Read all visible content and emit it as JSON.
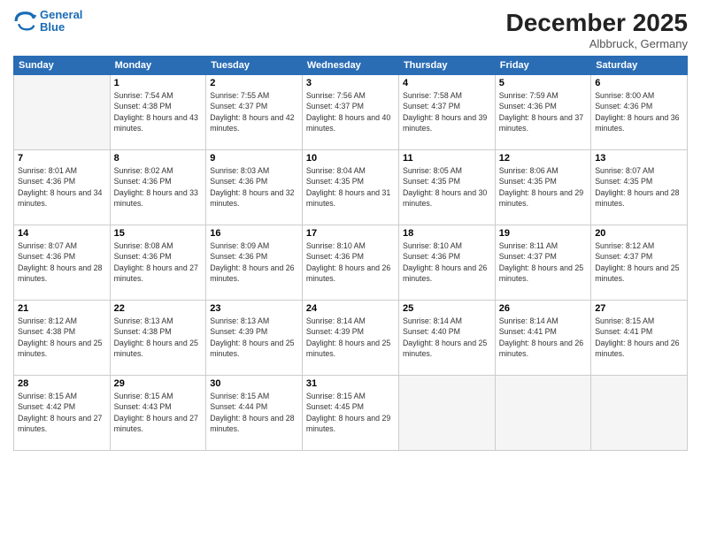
{
  "header": {
    "logo": {
      "line1": "General",
      "line2": "Blue"
    },
    "month_year": "December 2025",
    "location": "Albbruck, Germany"
  },
  "weekdays": [
    "Sunday",
    "Monday",
    "Tuesday",
    "Wednesday",
    "Thursday",
    "Friday",
    "Saturday"
  ],
  "weeks": [
    [
      {
        "day": "",
        "empty": true
      },
      {
        "day": "1",
        "sunrise": "7:54 AM",
        "sunset": "4:38 PM",
        "daylight": "8 hours and 43 minutes."
      },
      {
        "day": "2",
        "sunrise": "7:55 AM",
        "sunset": "4:37 PM",
        "daylight": "8 hours and 42 minutes."
      },
      {
        "day": "3",
        "sunrise": "7:56 AM",
        "sunset": "4:37 PM",
        "daylight": "8 hours and 40 minutes."
      },
      {
        "day": "4",
        "sunrise": "7:58 AM",
        "sunset": "4:37 PM",
        "daylight": "8 hours and 39 minutes."
      },
      {
        "day": "5",
        "sunrise": "7:59 AM",
        "sunset": "4:36 PM",
        "daylight": "8 hours and 37 minutes."
      },
      {
        "day": "6",
        "sunrise": "8:00 AM",
        "sunset": "4:36 PM",
        "daylight": "8 hours and 36 minutes."
      }
    ],
    [
      {
        "day": "7",
        "sunrise": "8:01 AM",
        "sunset": "4:36 PM",
        "daylight": "8 hours and 34 minutes."
      },
      {
        "day": "8",
        "sunrise": "8:02 AM",
        "sunset": "4:36 PM",
        "daylight": "8 hours and 33 minutes."
      },
      {
        "day": "9",
        "sunrise": "8:03 AM",
        "sunset": "4:36 PM",
        "daylight": "8 hours and 32 minutes."
      },
      {
        "day": "10",
        "sunrise": "8:04 AM",
        "sunset": "4:35 PM",
        "daylight": "8 hours and 31 minutes."
      },
      {
        "day": "11",
        "sunrise": "8:05 AM",
        "sunset": "4:35 PM",
        "daylight": "8 hours and 30 minutes."
      },
      {
        "day": "12",
        "sunrise": "8:06 AM",
        "sunset": "4:35 PM",
        "daylight": "8 hours and 29 minutes."
      },
      {
        "day": "13",
        "sunrise": "8:07 AM",
        "sunset": "4:35 PM",
        "daylight": "8 hours and 28 minutes."
      }
    ],
    [
      {
        "day": "14",
        "sunrise": "8:07 AM",
        "sunset": "4:36 PM",
        "daylight": "8 hours and 28 minutes."
      },
      {
        "day": "15",
        "sunrise": "8:08 AM",
        "sunset": "4:36 PM",
        "daylight": "8 hours and 27 minutes."
      },
      {
        "day": "16",
        "sunrise": "8:09 AM",
        "sunset": "4:36 PM",
        "daylight": "8 hours and 26 minutes."
      },
      {
        "day": "17",
        "sunrise": "8:10 AM",
        "sunset": "4:36 PM",
        "daylight": "8 hours and 26 minutes."
      },
      {
        "day": "18",
        "sunrise": "8:10 AM",
        "sunset": "4:36 PM",
        "daylight": "8 hours and 26 minutes."
      },
      {
        "day": "19",
        "sunrise": "8:11 AM",
        "sunset": "4:37 PM",
        "daylight": "8 hours and 25 minutes."
      },
      {
        "day": "20",
        "sunrise": "8:12 AM",
        "sunset": "4:37 PM",
        "daylight": "8 hours and 25 minutes."
      }
    ],
    [
      {
        "day": "21",
        "sunrise": "8:12 AM",
        "sunset": "4:38 PM",
        "daylight": "8 hours and 25 minutes."
      },
      {
        "day": "22",
        "sunrise": "8:13 AM",
        "sunset": "4:38 PM",
        "daylight": "8 hours and 25 minutes."
      },
      {
        "day": "23",
        "sunrise": "8:13 AM",
        "sunset": "4:39 PM",
        "daylight": "8 hours and 25 minutes."
      },
      {
        "day": "24",
        "sunrise": "8:14 AM",
        "sunset": "4:39 PM",
        "daylight": "8 hours and 25 minutes."
      },
      {
        "day": "25",
        "sunrise": "8:14 AM",
        "sunset": "4:40 PM",
        "daylight": "8 hours and 25 minutes."
      },
      {
        "day": "26",
        "sunrise": "8:14 AM",
        "sunset": "4:41 PM",
        "daylight": "8 hours and 26 minutes."
      },
      {
        "day": "27",
        "sunrise": "8:15 AM",
        "sunset": "4:41 PM",
        "daylight": "8 hours and 26 minutes."
      }
    ],
    [
      {
        "day": "28",
        "sunrise": "8:15 AM",
        "sunset": "4:42 PM",
        "daylight": "8 hours and 27 minutes."
      },
      {
        "day": "29",
        "sunrise": "8:15 AM",
        "sunset": "4:43 PM",
        "daylight": "8 hours and 27 minutes."
      },
      {
        "day": "30",
        "sunrise": "8:15 AM",
        "sunset": "4:44 PM",
        "daylight": "8 hours and 28 minutes."
      },
      {
        "day": "31",
        "sunrise": "8:15 AM",
        "sunset": "4:45 PM",
        "daylight": "8 hours and 29 minutes."
      },
      {
        "day": "",
        "empty": true
      },
      {
        "day": "",
        "empty": true
      },
      {
        "day": "",
        "empty": true
      }
    ]
  ]
}
